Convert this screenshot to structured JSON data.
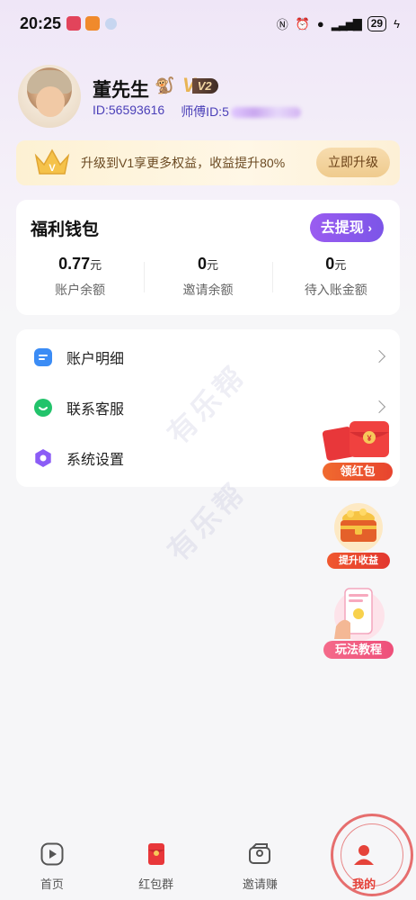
{
  "status_bar": {
    "time": "20:25",
    "battery": "29"
  },
  "profile": {
    "username": "董先生",
    "vip_mark": "V",
    "vip_level": "V2",
    "user_id": "ID:56593616",
    "master_id_prefix": "师傅ID:5"
  },
  "upgrade_banner": {
    "text": "升级到V1享更多权益，收益提升80%",
    "button": "立即升级"
  },
  "wallet": {
    "title": "福利钱包",
    "withdraw_button": "去提现",
    "stats": [
      {
        "value": "0.77",
        "unit": "元",
        "label": "账户余额"
      },
      {
        "value": "0",
        "unit": "元",
        "label": "邀请余额"
      },
      {
        "value": "0",
        "unit": "元",
        "label": "待入账金额"
      }
    ]
  },
  "menu": {
    "items": [
      {
        "label": "账户明细",
        "icon": "list-icon",
        "color": "#3b8cf5"
      },
      {
        "label": "联系客服",
        "icon": "chat-icon",
        "color": "#22c36b"
      },
      {
        "label": "系统设置",
        "icon": "settings-icon",
        "color": "#8b5cf6"
      }
    ]
  },
  "watermark": {
    "text": "有乐帮"
  },
  "floating": {
    "red_packet": "领红包",
    "boost": "提升收益",
    "tutorial": "玩法教程"
  },
  "bottom_nav": {
    "items": [
      {
        "label": "首页"
      },
      {
        "label": "红包群"
      },
      {
        "label": "邀请赚"
      },
      {
        "label": "我的"
      }
    ]
  },
  "colors": {
    "accent": "#7c55e8",
    "active_tab": "#e5433a",
    "id_text": "#4a3fb8"
  }
}
